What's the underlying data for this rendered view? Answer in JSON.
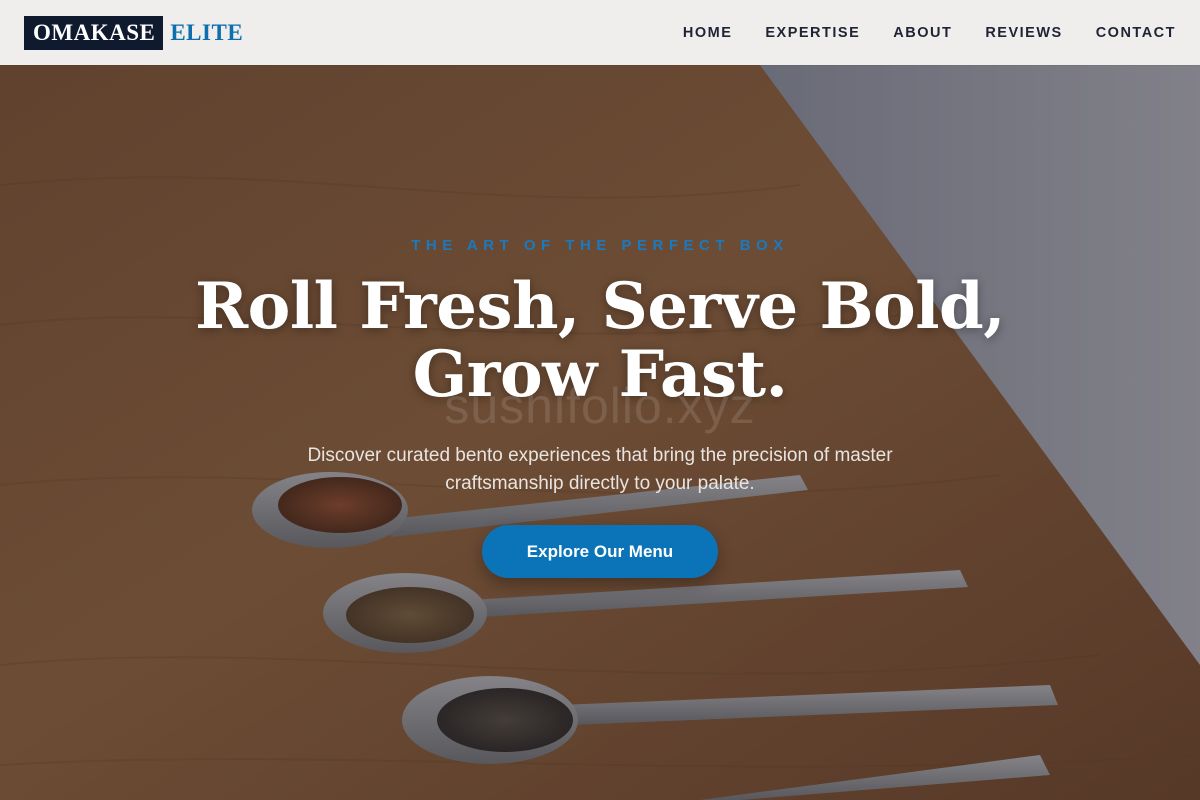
{
  "brand": {
    "name_primary": "OMAKASE",
    "name_accent": "ELITE"
  },
  "nav": {
    "items": [
      {
        "label": "HOME"
      },
      {
        "label": "EXPERTISE"
      },
      {
        "label": "ABOUT"
      },
      {
        "label": "REVIEWS"
      },
      {
        "label": "CONTACT"
      }
    ]
  },
  "hero": {
    "kicker": "THE ART OF THE PERFECT BOX",
    "headline_line1": "Roll Fresh, Serve Bold,",
    "headline_line2": "Grow Fast.",
    "watermark": "sushifolio.xyz",
    "subtext": "Discover curated bento experiences that bring the precision of master craftsmanship directly to your palate.",
    "cta_label": "Explore Our Menu",
    "background_image": "spice-spoons-on-wooden-table"
  },
  "colors": {
    "nav_bg": "#efeeed",
    "logo_dark": "#0f1a2e",
    "accent": "#0d6fad",
    "cta": "#0b74b8"
  }
}
